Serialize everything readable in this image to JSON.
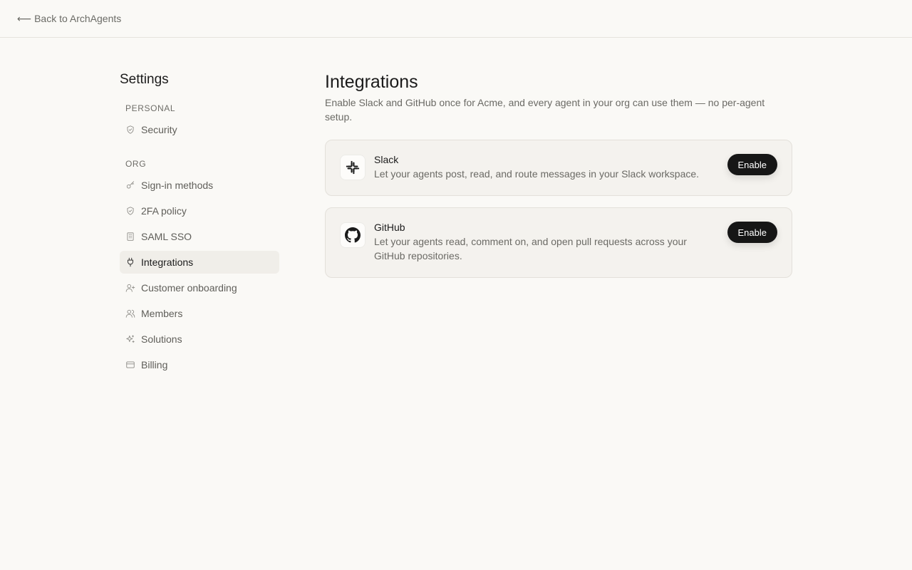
{
  "header": {
    "back_arrow": "⟵",
    "back_label": "Back to ArchAgents"
  },
  "sidebar": {
    "title": "Settings",
    "personal_label": "PERSONAL",
    "personal_items": [
      {
        "label": "Security",
        "icon": "shield-icon"
      }
    ],
    "org_label": "ORG",
    "org_items": [
      {
        "label": "Sign-in methods",
        "icon": "key-icon"
      },
      {
        "label": "2FA policy",
        "icon": "shield-icon"
      },
      {
        "label": "SAML SSO",
        "icon": "building-icon"
      },
      {
        "label": "Integrations",
        "icon": "plug-icon",
        "active": true
      },
      {
        "label": "Customer onboarding",
        "icon": "user-plus-icon"
      },
      {
        "label": "Members",
        "icon": "users-icon"
      },
      {
        "label": "Solutions",
        "icon": "sparkles-icon"
      },
      {
        "label": "Billing",
        "icon": "credit-card-icon"
      }
    ]
  },
  "main": {
    "title": "Integrations",
    "description": "Enable Slack and GitHub once for Acme, and every agent in your org can use them — no per-agent setup.",
    "integrations": [
      {
        "name": "Slack",
        "icon": "slack-logo-icon",
        "description": "Let your agents post, read, and route messages in your Slack workspace.",
        "button_label": "Enable"
      },
      {
        "name": "GitHub",
        "icon": "github-logo-icon",
        "description": "Let your agents read, comment on, and open pull requests across your GitHub repositories.",
        "button_label": "Enable"
      }
    ]
  },
  "colors": {
    "background": "#faf9f6",
    "card_background": "#f4f2ee",
    "active_nav": "#f0eee9",
    "button": "#161616"
  }
}
